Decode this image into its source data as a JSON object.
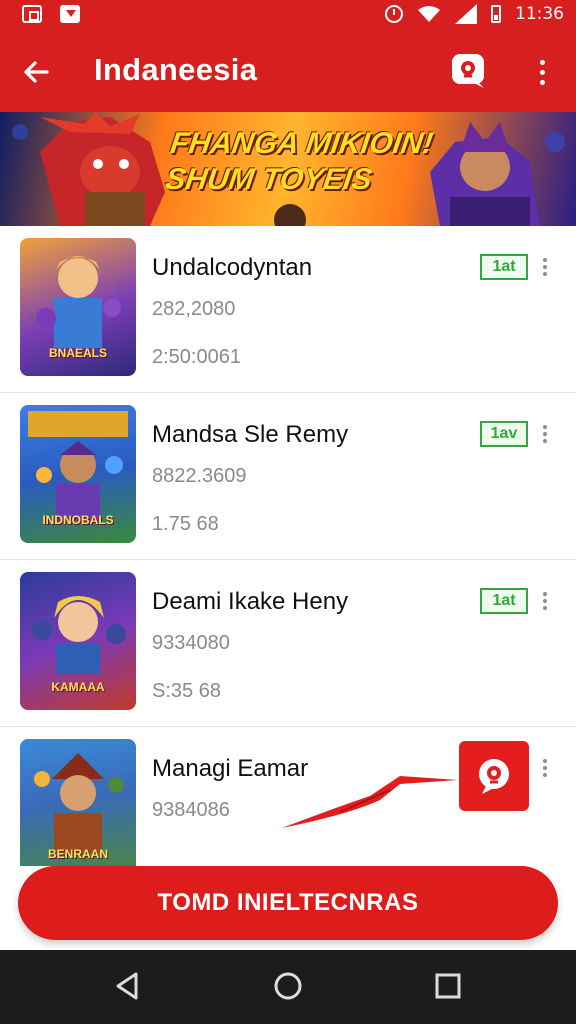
{
  "status_bar": {
    "time": "11:36",
    "icons": [
      "notification-icon",
      "mail-icon",
      "alarm-icon",
      "wifi-icon",
      "signal-icon",
      "battery-icon"
    ]
  },
  "app_bar": {
    "title": "Indaneesia",
    "icons": [
      "back-arrow-icon",
      "chat-bubble-icon",
      "more-vert-icon"
    ]
  },
  "banner": {
    "line1": "FHANGA MIKIOIN!",
    "line2": "SHUM TOYEIS"
  },
  "list": {
    "items": [
      {
        "title": "Undalcodyntan",
        "meta": "282,2080",
        "sub": "2:50:0061",
        "tag": "1at",
        "thumb_label": "BNAEALS"
      },
      {
        "title": "Mandsa Sle Remy",
        "meta": "8822.3609",
        "sub": "1.75     68",
        "tag": "1av",
        "thumb_label": "INDNOBALS"
      },
      {
        "title": "Deami Ikake Heny",
        "meta": "9334080",
        "sub": "S:35     68",
        "tag": "1at",
        "thumb_label": "KAMAAA"
      },
      {
        "title": "Managi Eamar",
        "meta": "9384086",
        "sub": "",
        "tag": "",
        "thumb_label": "BENRAAN"
      }
    ]
  },
  "cta": {
    "label": "TOMD INIELTECNRAS"
  },
  "colors": {
    "primary": "#d81f1f",
    "tag_green": "#33a63f",
    "nav_bg": "#1c1c1c"
  }
}
